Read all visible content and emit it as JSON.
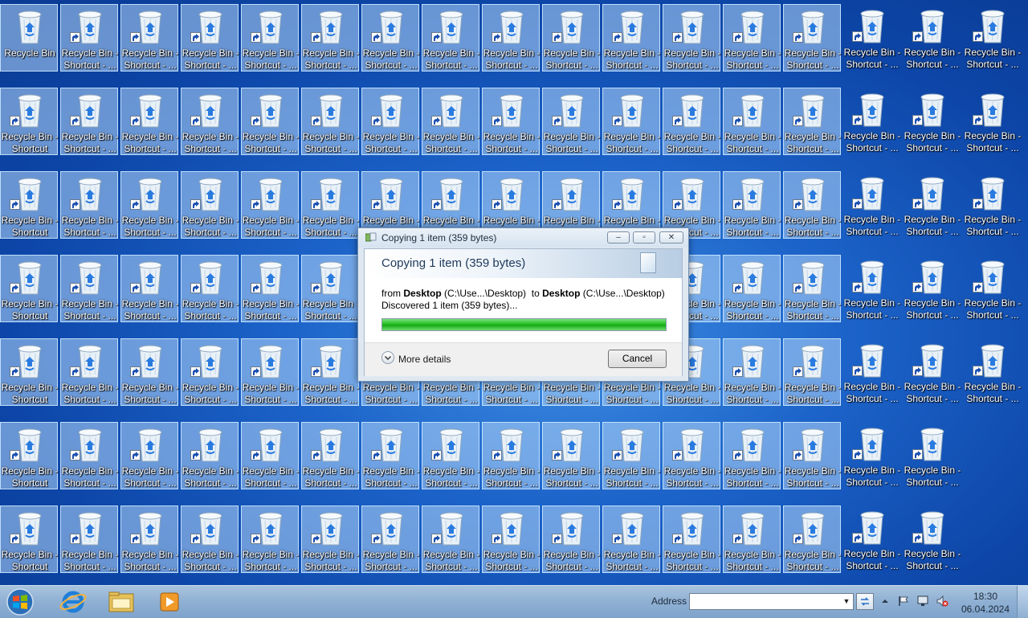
{
  "desktop": {
    "recycle_bin_label": "Recycle Bin",
    "shortcut_label_line1": "Recycle Bin -",
    "shortcut_label_line2": "Shortcut - ...",
    "first_column_line2": "Shortcut"
  },
  "dialog": {
    "title": "Copying 1 item (359 bytes)",
    "heading": "Copying 1 item (359 bytes)",
    "from_prefix": "from",
    "from_name": "Desktop",
    "from_path": "(C:\\Use...\\Desktop)",
    "to_prefix": "to",
    "to_name": "Desktop",
    "to_path": "(C:\\Use...\\Desktop)",
    "discovered": "Discovered 1 item (359 bytes)...",
    "progress_fraction": 1.0,
    "more_details": "More details",
    "cancel": "Cancel",
    "minimize_glyph": "–",
    "maximize_glyph": "▫",
    "close_glyph": "✕"
  },
  "taskbar": {
    "address_label": "Address",
    "address_value": "",
    "dropdown_glyph": "▼",
    "time": "18:30",
    "date": "06.04.2024",
    "pinned": [
      "internet-explorer-icon",
      "windows-explorer-icon",
      "media-player-icon"
    ]
  },
  "colors": {
    "desktop_blue": "#1c63c9",
    "progress_green": "#1bbb1b",
    "selection": "#b4d7fa"
  }
}
